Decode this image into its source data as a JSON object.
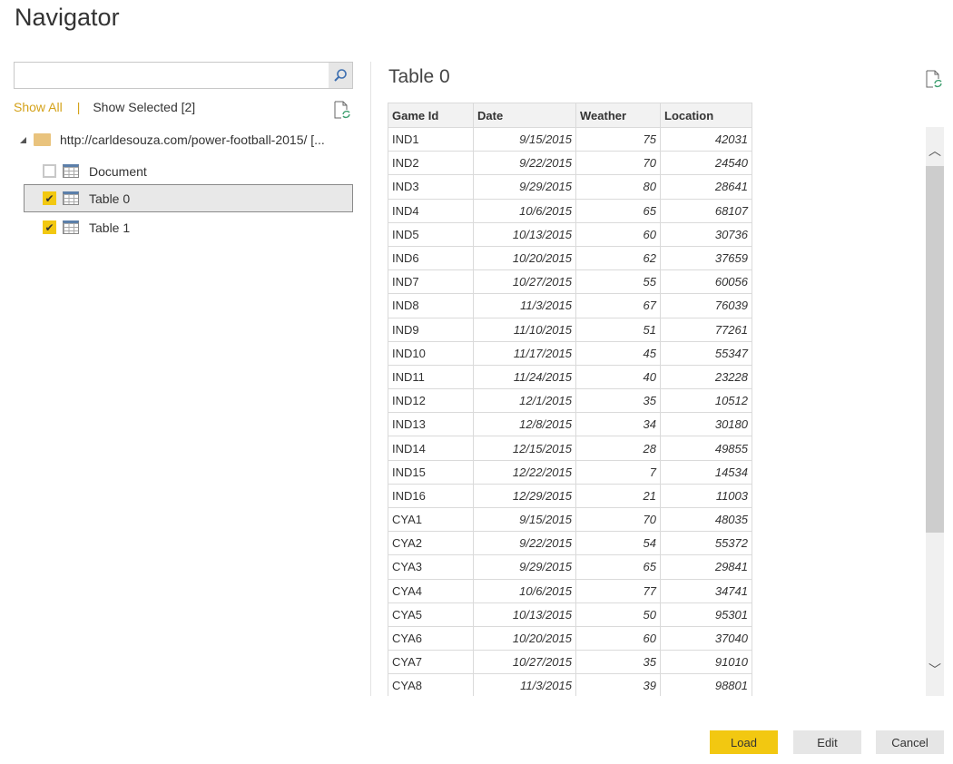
{
  "window": {
    "title": "Navigator"
  },
  "search": {
    "value": "",
    "placeholder": ""
  },
  "filters": {
    "show_all": "Show All",
    "separator": "|",
    "show_selected": "Show Selected [2]"
  },
  "tree": {
    "root": "http://carldesouza.com/power-football-2015/ [...",
    "items": [
      {
        "label": "Document",
        "checked": false,
        "selected": false
      },
      {
        "label": "Table 0",
        "checked": true,
        "selected": true
      },
      {
        "label": "Table 1",
        "checked": true,
        "selected": false
      }
    ]
  },
  "preview": {
    "title": "Table 0",
    "columns": [
      "Game Id",
      "Date",
      "Weather",
      "Location"
    ],
    "rows": [
      [
        "IND1",
        "9/15/2015",
        "75",
        "42031"
      ],
      [
        "IND2",
        "9/22/2015",
        "70",
        "24540"
      ],
      [
        "IND3",
        "9/29/2015",
        "80",
        "28641"
      ],
      [
        "IND4",
        "10/6/2015",
        "65",
        "68107"
      ],
      [
        "IND5",
        "10/13/2015",
        "60",
        "30736"
      ],
      [
        "IND6",
        "10/20/2015",
        "62",
        "37659"
      ],
      [
        "IND7",
        "10/27/2015",
        "55",
        "60056"
      ],
      [
        "IND8",
        "11/3/2015",
        "67",
        "76039"
      ],
      [
        "IND9",
        "11/10/2015",
        "51",
        "77261"
      ],
      [
        "IND10",
        "11/17/2015",
        "45",
        "55347"
      ],
      [
        "IND11",
        "11/24/2015",
        "40",
        "23228"
      ],
      [
        "IND12",
        "12/1/2015",
        "35",
        "10512"
      ],
      [
        "IND13",
        "12/8/2015",
        "34",
        "30180"
      ],
      [
        "IND14",
        "12/15/2015",
        "28",
        "49855"
      ],
      [
        "IND15",
        "12/22/2015",
        "7",
        "14534"
      ],
      [
        "IND16",
        "12/29/2015",
        "21",
        "11003"
      ],
      [
        "CYA1",
        "9/15/2015",
        "70",
        "48035"
      ],
      [
        "CYA2",
        "9/22/2015",
        "54",
        "55372"
      ],
      [
        "CYA3",
        "9/29/2015",
        "65",
        "29841"
      ],
      [
        "CYA4",
        "10/6/2015",
        "77",
        "34741"
      ],
      [
        "CYA5",
        "10/13/2015",
        "50",
        "95301"
      ],
      [
        "CYA6",
        "10/20/2015",
        "60",
        "37040"
      ],
      [
        "CYA7",
        "10/27/2015",
        "35",
        "91010"
      ],
      [
        "CYA8",
        "11/3/2015",
        "39",
        "98801"
      ]
    ]
  },
  "buttons": {
    "load": "Load",
    "edit": "Edit",
    "cancel": "Cancel"
  },
  "colors": {
    "accent": "#f2c811",
    "link": "#d4a21a"
  }
}
